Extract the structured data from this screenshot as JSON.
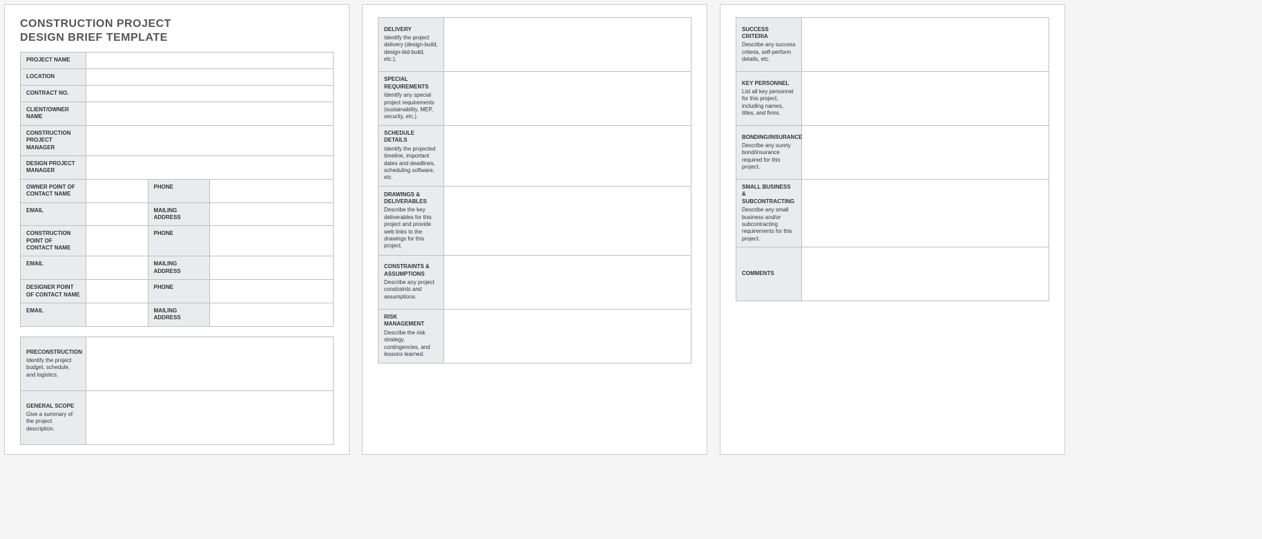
{
  "title_line1": "CONSTRUCTION PROJECT",
  "title_line2": "DESIGN BRIEF TEMPLATE",
  "info": {
    "project_name": "PROJECT NAME",
    "location": "LOCATION",
    "contract_no": "CONTRACT NO.",
    "client_owner": "CLIENT/OWNER NAME",
    "cpm": "CONSTRUCTION PROJECT MANAGER",
    "dpm": "DESIGN PROJECT MANAGER",
    "owner_poc": "OWNER POINT OF CONTACT NAME",
    "construction_poc": "CONSTRUCTION POINT OF CONTACT NAME",
    "designer_poc": "DESIGNER POINT OF CONTACT NAME",
    "phone": "PHONE",
    "email": "EMAIL",
    "mailing": "MAILING ADDRESS"
  },
  "sections": {
    "preconstruction": {
      "hdr": "PRECONSTRUCTION",
      "desc": "Identify the project budget, schedule, and logistics."
    },
    "general_scope": {
      "hdr": "GENERAL SCOPE",
      "desc": "Give a summary of the project description."
    },
    "delivery": {
      "hdr": "DELIVERY",
      "desc": "Identify the project delivery (design-build, design-bid-build, etc.)."
    },
    "special_req": {
      "hdr": "SPECIAL REQUIREMENTS",
      "desc": "Identify any special project requirements (sustainability, MEP, security, etc.)."
    },
    "schedule": {
      "hdr": "SCHEDULE DETAILS",
      "desc": "Identify the projected timeline, important dates and deadlines, scheduling software, etc."
    },
    "drawings": {
      "hdr": "DRAWINGS & DELIVERABLES",
      "desc": "Describe the key deliverables for this project and provide web links to the drawings for this project."
    },
    "constraints": {
      "hdr": "CONSTRAINTS & ASSUMPTIONS",
      "desc": "Describe any project constraints and assumptions."
    },
    "risk": {
      "hdr": "RISK MANAGEMENT",
      "desc": "Describe the risk strategy, contingencies, and lessons learned."
    },
    "success": {
      "hdr": "SUCCESS CRITERIA",
      "desc": "Describe any success criteria, self-perform details, etc."
    },
    "personnel": {
      "hdr": "KEY PERSONNEL",
      "desc": "List all key personnel for this project, including names, titles, and firms."
    },
    "bonding": {
      "hdr": "BONDING/INSURANCE",
      "desc": "Describe any surety bond/insurance required for this project."
    },
    "small_biz": {
      "hdr": "SMALL BUSINESS & SUBCONTRACTING",
      "desc": "Describe any small business and/or subcontracting requirements for this project."
    },
    "comments": {
      "hdr": "COMMENTS",
      "desc": ""
    }
  }
}
